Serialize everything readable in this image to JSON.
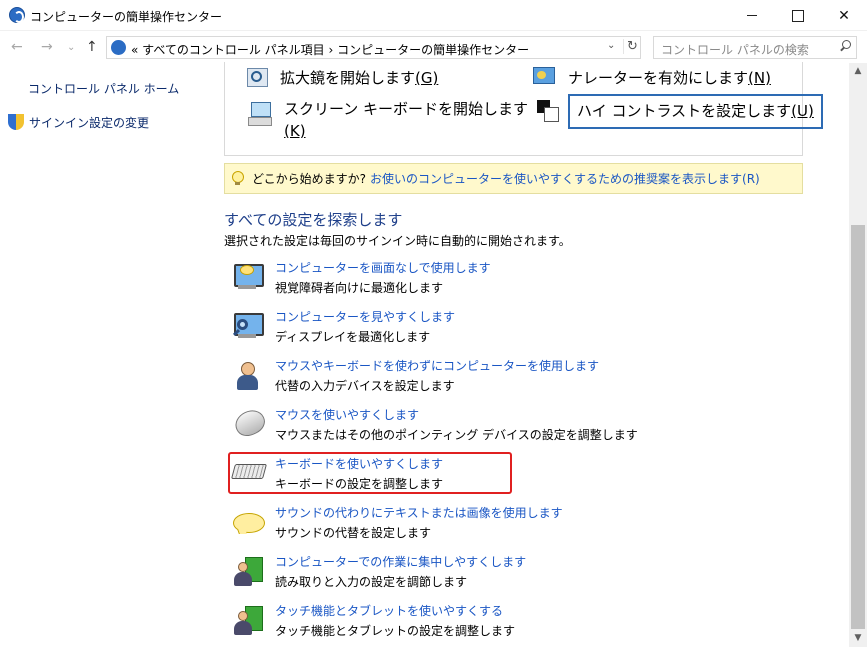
{
  "window": {
    "title": "コンピューターの簡単操作センター",
    "minimize_icon": "minimize-icon",
    "maximize_icon": "maximize-icon",
    "close_glyph": "✕"
  },
  "nav": {
    "back": "←",
    "forward": "→",
    "recent": "⌄",
    "up": "↑"
  },
  "address": {
    "path": "« すべてのコントロール パネル項目 › コンピューターの簡単操作センター",
    "dropdown": "⌄",
    "refresh": "↻"
  },
  "search": {
    "placeholder": "コントロール パネルの検索"
  },
  "left_pane": {
    "home": "コントロール パネル ホーム",
    "signin": "サインイン設定の変更"
  },
  "quick": {
    "magnifier": {
      "label": "拡大鏡を開始します",
      "key": "(G)"
    },
    "narrator": {
      "label": "ナレーターを有効にします",
      "key": "(N)"
    },
    "osk": {
      "label": "スクリーン キーボードを開始します",
      "key": "(K)"
    },
    "contrast": {
      "label": "ハイ コントラストを設定します",
      "key": "(U)"
    }
  },
  "tip": {
    "question": "どこから始めますか?",
    "link": "お使いのコンピューターを使いやすくするための推奨案を表示します(R)"
  },
  "section": {
    "title": "すべての設定を探索します",
    "subtitle": "選択された設定は毎回のサインイン時に自動的に開始されます。"
  },
  "items": [
    {
      "link": "コンピューターを画面なしで使用します",
      "desc": "視覚障碍者向けに最適化します",
      "icon": "monitor-bubble-icon"
    },
    {
      "link": "コンピューターを見やすくします",
      "desc": "ディスプレイを最適化します",
      "icon": "monitor-magnifier-icon"
    },
    {
      "link": "マウスやキーボードを使わずにコンピューターを使用します",
      "desc": "代替の入力デバイスを設定します",
      "icon": "person-icon"
    },
    {
      "link": "マウスを使いやすくします",
      "desc": "マウスまたはその他のポインティング デバイスの設定を調整します",
      "icon": "mouse-icon"
    },
    {
      "link": "キーボードを使いやすくします",
      "desc": "キーボードの設定を調整します",
      "icon": "keyboard-icon"
    },
    {
      "link": "サウンドの代わりにテキストまたは画像を使用します",
      "desc": "サウンドの代替を設定します",
      "icon": "speech-bubble-icon"
    },
    {
      "link": "コンピューターでの作業に集中しやすくします",
      "desc": "読み取りと入力の設定を調節します",
      "icon": "people-icon"
    },
    {
      "link": "タッチ機能とタブレットを使いやすくする",
      "desc": "タッチ機能とタブレットの設定を調整します",
      "icon": "people-tablet-icon"
    }
  ],
  "colors": {
    "link": "#1a56c4",
    "heading": "#1e3f8a",
    "highlight": "#e02020",
    "tip_bg": "#fff9cc"
  }
}
